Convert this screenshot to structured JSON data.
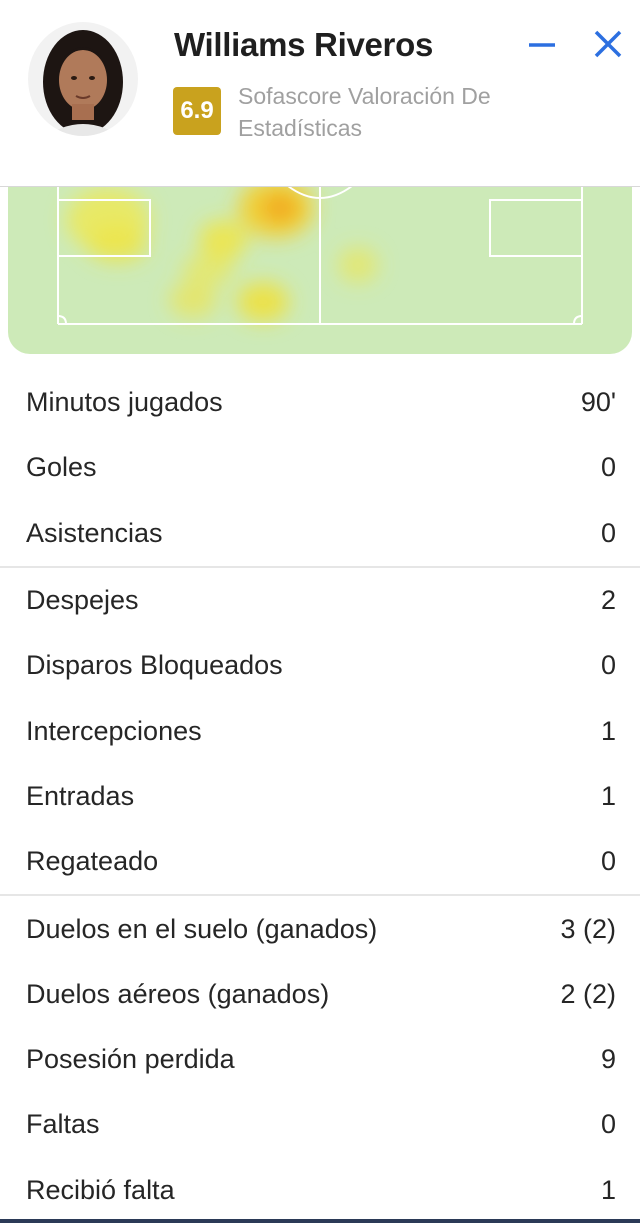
{
  "player": {
    "name": "Williams Riveros",
    "rating": "6.9",
    "rating_label": "Sofascore Valoración De Estadísticas"
  },
  "colors": {
    "rating_badge": "#c9a21e",
    "accent_blue": "#2c6fe0",
    "pitch": "#cdeab8"
  },
  "icons": {
    "minimize": "minimize-icon",
    "close": "close-icon"
  },
  "stats": {
    "groups": [
      {
        "rows": [
          {
            "label": "Minutos jugados",
            "value": "90'"
          },
          {
            "label": "Goles",
            "value": "0"
          },
          {
            "label": "Asistencias",
            "value": "0"
          }
        ]
      },
      {
        "rows": [
          {
            "label": "Despejes",
            "value": "2"
          },
          {
            "label": "Disparos Bloqueados",
            "value": "0"
          },
          {
            "label": "Intercepciones",
            "value": "1"
          },
          {
            "label": "Entradas",
            "value": "1"
          },
          {
            "label": "Regateado",
            "value": "0"
          }
        ]
      },
      {
        "rows": [
          {
            "label": "Duelos en el suelo (ganados)",
            "value": "3 (2)"
          },
          {
            "label": "Duelos aéreos (ganados)",
            "value": "2 (2)"
          },
          {
            "label": "Posesión perdida",
            "value": "9"
          },
          {
            "label": "Faltas",
            "value": "0"
          },
          {
            "label": "Recibió falta",
            "value": "1"
          }
        ]
      }
    ]
  }
}
